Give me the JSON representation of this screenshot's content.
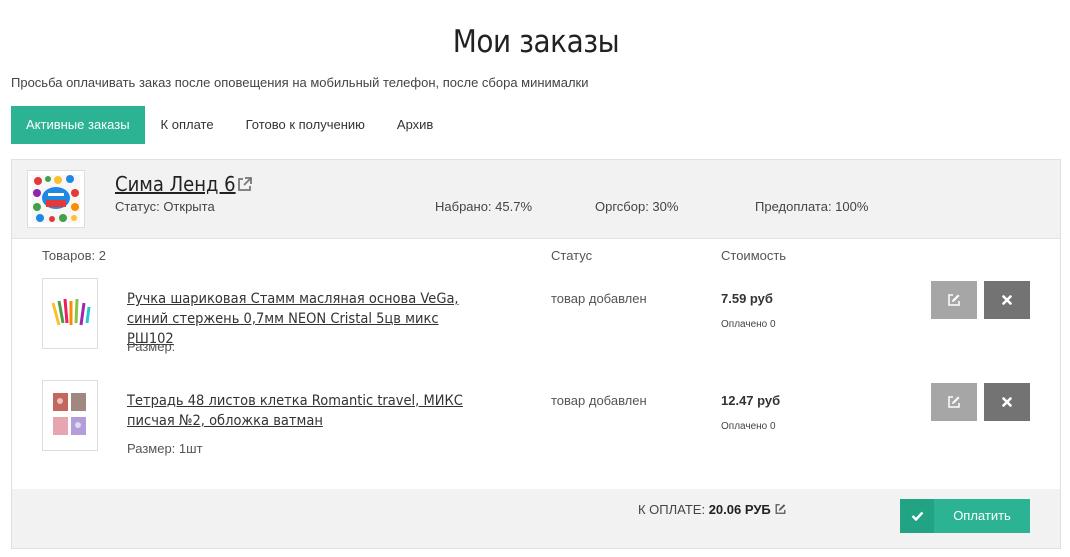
{
  "page": {
    "title": "Мои заказы",
    "notice": "Просьба оплачивать заказ после оповещения на мобильный телефон, после сбора минималки"
  },
  "tabs": [
    {
      "label": "Активные заказы",
      "active": true
    },
    {
      "label": "К оплате",
      "active": false
    },
    {
      "label": "Готово к получению",
      "active": false
    },
    {
      "label": "Архив",
      "active": false
    }
  ],
  "order": {
    "store_name": "Сима Ленд 6",
    "status": "Статус: Открыта",
    "collected": "Набрано: 45.7%",
    "org_fee": "Оргсбор: 30%",
    "prepayment": "Предоплата: 100%",
    "columns": {
      "items_count": "Товаров: 2",
      "status": "Статус",
      "cost": "Стоимость"
    },
    "items": [
      {
        "name": "Ручка шариковая Стамм масляная основа VeGa, синий стержень 0,7мм NEON Cristal 5цв микс РШ102",
        "size": "Размер:",
        "status": "товар добавлен",
        "price": "7.59 руб",
        "paid": "Оплачено 0"
      },
      {
        "name": "Тетрадь 48 листов клетка Romantic travel, МИКС писчая №2, обложка ватман",
        "size": "Размер: 1шт",
        "status": "товар добавлен",
        "price": "12.47 руб",
        "paid": "Оплачено 0"
      }
    ],
    "total_label": "К ОПЛАТЕ:",
    "total_value": "20.06 РУБ",
    "pay_button": "Оплатить"
  },
  "colors": {
    "accent": "#2bb394",
    "accent_dark": "#22a383",
    "edit_button": "#a6a6a6",
    "delete_button": "#737373",
    "panel_bg": "#f2f2f2"
  },
  "icons": {
    "external_link": "external-link-icon",
    "edit": "edit-icon",
    "delete": "close-icon",
    "pay": "check-icon"
  }
}
